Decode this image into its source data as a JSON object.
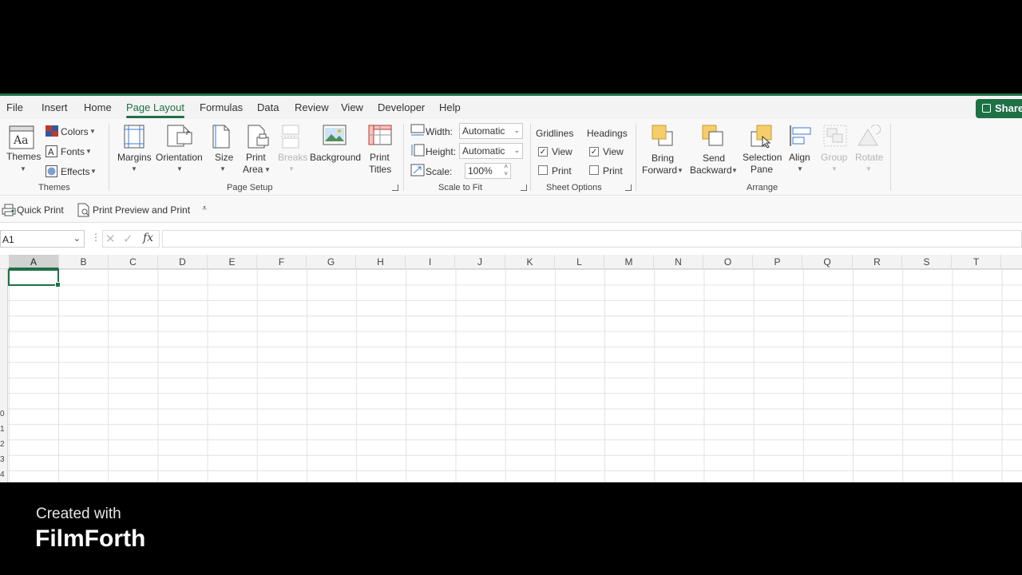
{
  "tabs": [
    "File",
    "Insert",
    "Home",
    "Page Layout",
    "Formulas",
    "Data",
    "Review",
    "View",
    "Developer",
    "Help"
  ],
  "active_tab": "Page Layout",
  "share_label": "Share",
  "ribbon": {
    "themes": {
      "themes_label": "Themes",
      "colors_label": "Colors",
      "fonts_label": "Fonts",
      "effects_label": "Effects",
      "group_label": "Themes"
    },
    "page_setup": {
      "margins_label": "Margins",
      "orientation_label": "Orientation",
      "size_label": "Size",
      "print_area_line1": "Print",
      "print_area_line2": "Area",
      "breaks_label": "Breaks",
      "background_label": "Background",
      "print_titles_line1": "Print",
      "print_titles_line2": "Titles",
      "group_label": "Page Setup"
    },
    "scale_to_fit": {
      "width_label": "Width:",
      "width_value": "Automatic",
      "height_label": "Height:",
      "height_value": "Automatic",
      "scale_label": "Scale:",
      "scale_value": "100%",
      "group_label": "Scale to Fit"
    },
    "sheet_options": {
      "gridlines_label": "Gridlines",
      "headings_label": "Headings",
      "gridlines_view_label": "View",
      "gridlines_print_label": "Print",
      "headings_view_label": "View",
      "headings_print_label": "Print",
      "gridlines_view_checked": true,
      "gridlines_print_checked": false,
      "headings_view_checked": true,
      "headings_print_checked": false,
      "group_label": "Sheet Options"
    },
    "arrange": {
      "bring_forward_line1": "Bring",
      "bring_forward_line2": "Forward",
      "send_backward_line1": "Send",
      "send_backward_line2": "Backward",
      "selection_pane_line1": "Selection",
      "selection_pane_line2": "Pane",
      "align_label": "Align",
      "group_label_btn": "Group",
      "rotate_label": "Rotate",
      "group_label": "Arrange"
    }
  },
  "qat": {
    "quick_print_label": "Quick Print",
    "print_preview_label": "Print Preview and Print"
  },
  "formula_bar": {
    "name_box": "A1",
    "fx_label": "fx",
    "formula_value": ""
  },
  "grid": {
    "columns": [
      "A",
      "B",
      "C",
      "D",
      "E",
      "F",
      "G",
      "H",
      "I",
      "J",
      "K",
      "L",
      "M",
      "N",
      "O",
      "P",
      "Q",
      "R",
      "S",
      "T"
    ],
    "selected_column": "A",
    "selected_cell": "A1",
    "visible_row_fragments": [
      "0",
      "1",
      "2",
      "3",
      "4"
    ]
  },
  "watermark": {
    "line1": "Created with",
    "line2": "FilmForth"
  },
  "colors": {
    "accent": "#1e7145",
    "background": "#000000"
  }
}
